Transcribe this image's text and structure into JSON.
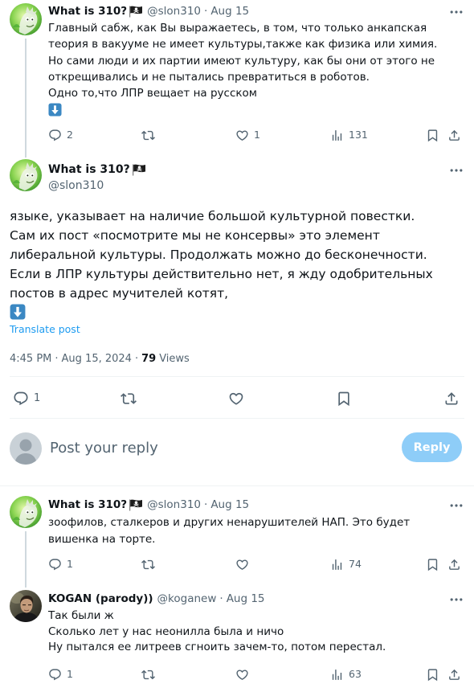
{
  "meta_separator": "·",
  "colors": {
    "text": "#0f1419",
    "secondary_text": "#536471",
    "link": "#1d9bf0",
    "divider": "#eff3f4",
    "thread_line": "#cfd9de",
    "reply_button": "#8ecdf8",
    "emoji_blue": "#3b88c3"
  },
  "icons": {
    "reply": "reply-icon",
    "repost": "repost-icon",
    "like": "heart-icon",
    "views": "views-icon",
    "bookmark": "bookmark-icon",
    "share": "share-icon",
    "more": "more-icon",
    "name_badge": "pirate-flag-icon",
    "inline_emoji": "down-arrow-emoji-icon"
  },
  "thread": {
    "parent_post": {
      "author": {
        "name": "What is 310?",
        "name_badge_icon": "pirate-flag-icon",
        "handle": "@slon310"
      },
      "date": "Aug 15",
      "text_lines": [
        "Главный сабж, как Вы выражаетесь, в том, что только анкапская",
        "теория в вакууме не имеет культуры,также как физика или химия.",
        "Но сами люди и их партии имеют культуру, как бы они от этого не",
        "открещивались и не пытались превратиться в роботов.",
        "Одно то,что ЛПР вещает на русском"
      ],
      "trailing_emoji_icon": "down-arrow-emoji-icon",
      "stats": {
        "replies": "2",
        "likes": "1",
        "views": "131"
      }
    },
    "main_post": {
      "author": {
        "name": "What is 310?",
        "name_badge_icon": "pirate-flag-icon",
        "handle": "@slon310"
      },
      "text_lines": [
        "языке, указывает на наличие большой культурной повестки.",
        "Сам их пост «посмотрите мы не консервы» это элемент",
        "либеральной культуры. Продолжать можно до бесконечности.",
        "Если в ЛПР культуры действительно нет, я жду одобрительных",
        "постов в адрес мучителей котят,"
      ],
      "trailing_emoji_icon": "down-arrow-emoji-icon",
      "translate_label": "Translate post",
      "time": "4:45 PM",
      "date": "Aug 15, 2024",
      "views_count": "79",
      "views_label": "Views",
      "stats": {
        "replies": "1"
      }
    },
    "reply_composer": {
      "placeholder": "Post your reply",
      "button_label": "Reply"
    },
    "replies": [
      {
        "author": {
          "name": "What is 310?",
          "name_badge_icon": "pirate-flag-icon",
          "handle": "@slon310"
        },
        "date": "Aug 15",
        "text_lines": [
          "зоофилов, сталкеров и других ненарушителей НАП. Это будет",
          "вишенка на торте."
        ],
        "stats": {
          "replies": "1",
          "views": "74"
        }
      },
      {
        "author": {
          "name": "KOGAN (parody))",
          "handle": "@koganew"
        },
        "date": "Aug 15",
        "text_lines": [
          "Так были ж",
          "Сколько лет у нас неонилла была и ничо",
          "Ну пытался ее литреев сгноить зачем-то, потом перестал."
        ],
        "stats": {
          "replies": "1",
          "views": "63"
        }
      }
    ]
  }
}
